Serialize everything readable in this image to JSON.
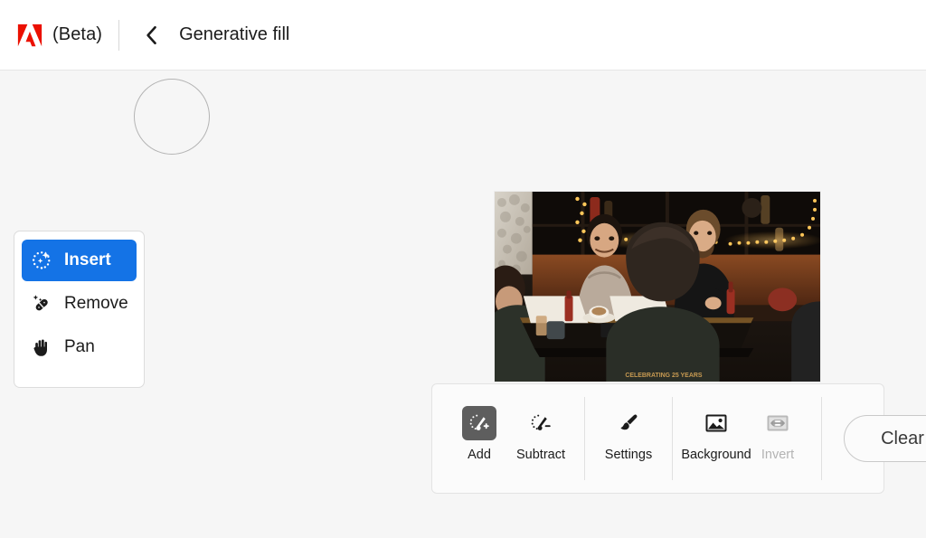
{
  "header": {
    "logo_icon": "adobe-logo",
    "beta_label": "(Beta)",
    "back_icon": "chevron-left-icon",
    "title": "Generative fill"
  },
  "colors": {
    "accent_blue": "#1473e6",
    "logo_red": "#eb1000",
    "selected_gray": "#5e5e5e",
    "canvas_bg": "#f6f6f6",
    "header_bg": "#ffffff",
    "disabled_text": "#b3b3b3"
  },
  "canvas": {
    "brush_cursor_icon": "brush-cursor-ring",
    "image": {
      "alt": "four people seated around a table in a dimly lit bar with string lights",
      "shirt_text": "CELEBRATING 25 YEARS"
    }
  },
  "tool_panel": {
    "items": [
      {
        "label": "Insert",
        "icon": "sparkle-circle-icon",
        "selected": true
      },
      {
        "label": "Remove",
        "icon": "healing-brush-icon",
        "selected": false
      },
      {
        "label": "Pan",
        "icon": "hand-icon",
        "selected": false
      }
    ]
  },
  "option_bar": {
    "selection_tools": [
      {
        "label": "Add",
        "icon": "brush-add-icon",
        "selected": true,
        "disabled": false
      },
      {
        "label": "Subtract",
        "icon": "brush-subtract-icon",
        "selected": false,
        "disabled": false
      }
    ],
    "brush_tools": [
      {
        "label": "Settings",
        "icon": "paintbrush-icon",
        "selected": false,
        "disabled": false
      }
    ],
    "mask_tools": [
      {
        "label": "Background",
        "icon": "image-icon",
        "selected": false,
        "disabled": false
      },
      {
        "label": "Invert",
        "icon": "invert-icon",
        "selected": false,
        "disabled": true
      }
    ],
    "clear_label": "Clear"
  }
}
